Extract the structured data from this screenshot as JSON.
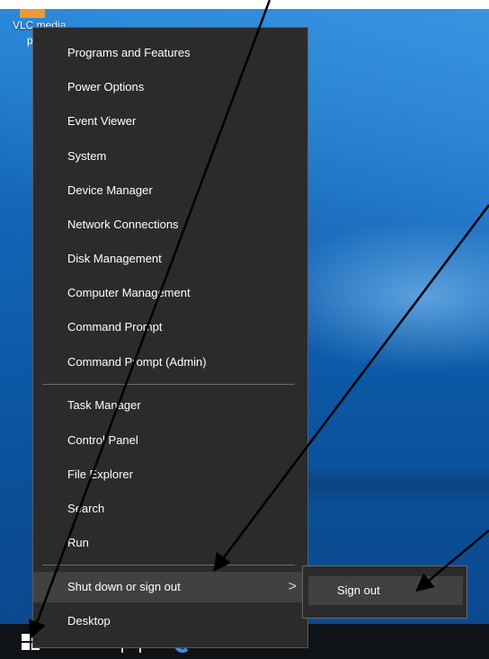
{
  "desktop": {
    "icon_label": "VLC media",
    "icon_label_line2": "p"
  },
  "menu": {
    "items": [
      {
        "label": "Programs and Features"
      },
      {
        "label": "Power Options"
      },
      {
        "label": "Event Viewer"
      },
      {
        "label": "System"
      },
      {
        "label": "Device Manager"
      },
      {
        "label": "Network Connections"
      },
      {
        "label": "Disk Management"
      },
      {
        "label": "Computer Management"
      },
      {
        "label": "Command Prompt"
      },
      {
        "label": "Command Prompt (Admin)"
      },
      {
        "label": "Task Manager"
      },
      {
        "label": "Control Panel"
      },
      {
        "label": "File Explorer"
      },
      {
        "label": "Search"
      },
      {
        "label": "Run"
      },
      {
        "label": "Shut down or sign out",
        "submenu_arrow": ">"
      },
      {
        "label": "Desktop"
      }
    ]
  },
  "submenu": {
    "items": [
      {
        "label": "Sign out"
      }
    ]
  },
  "taskbar": {
    "icons": [
      "windows-logo-icon",
      "search-icon",
      "task-view-icon",
      "edge-icon"
    ]
  },
  "annotation_color": "#000000"
}
